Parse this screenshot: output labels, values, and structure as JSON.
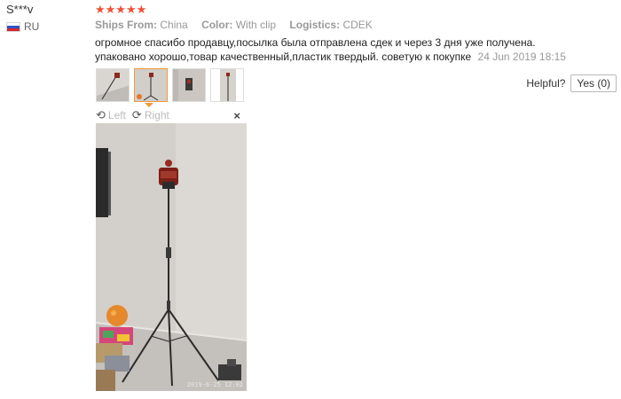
{
  "reviewer": {
    "name": "S***v",
    "country": "RU"
  },
  "review": {
    "rating": 5,
    "stars_text": "★★★★★",
    "meta": [
      {
        "key": "Ships From:",
        "value": "China"
      },
      {
        "key": "Color:",
        "value": "With clip"
      },
      {
        "key": "Logistics:",
        "value": "CDEK"
      }
    ],
    "text_line1": "огромное спасибо продавцу,посылка была отправлена сдек и через 3 дня уже получена.",
    "text_line2": "упаковано хорошо,товар качественный,пластик твердый. советую к покупке",
    "date": "24 Jun 2019 18:15"
  },
  "helpful": {
    "label": "Helpful?",
    "yes_label": "Yes (0)"
  },
  "viewer": {
    "rotate_left": "Left",
    "rotate_right": "Right",
    "close": "×",
    "photo_timestamp": "2019-6-25 12:02"
  },
  "colors": {
    "star": "#f04f36",
    "active_thumb_border": "#f29a3b",
    "muted_text": "#999999"
  },
  "icons": {
    "rotate_left": "rotate-left-icon",
    "rotate_right": "rotate-right-icon",
    "close": "close-icon",
    "flag": "flag-ru-icon"
  }
}
